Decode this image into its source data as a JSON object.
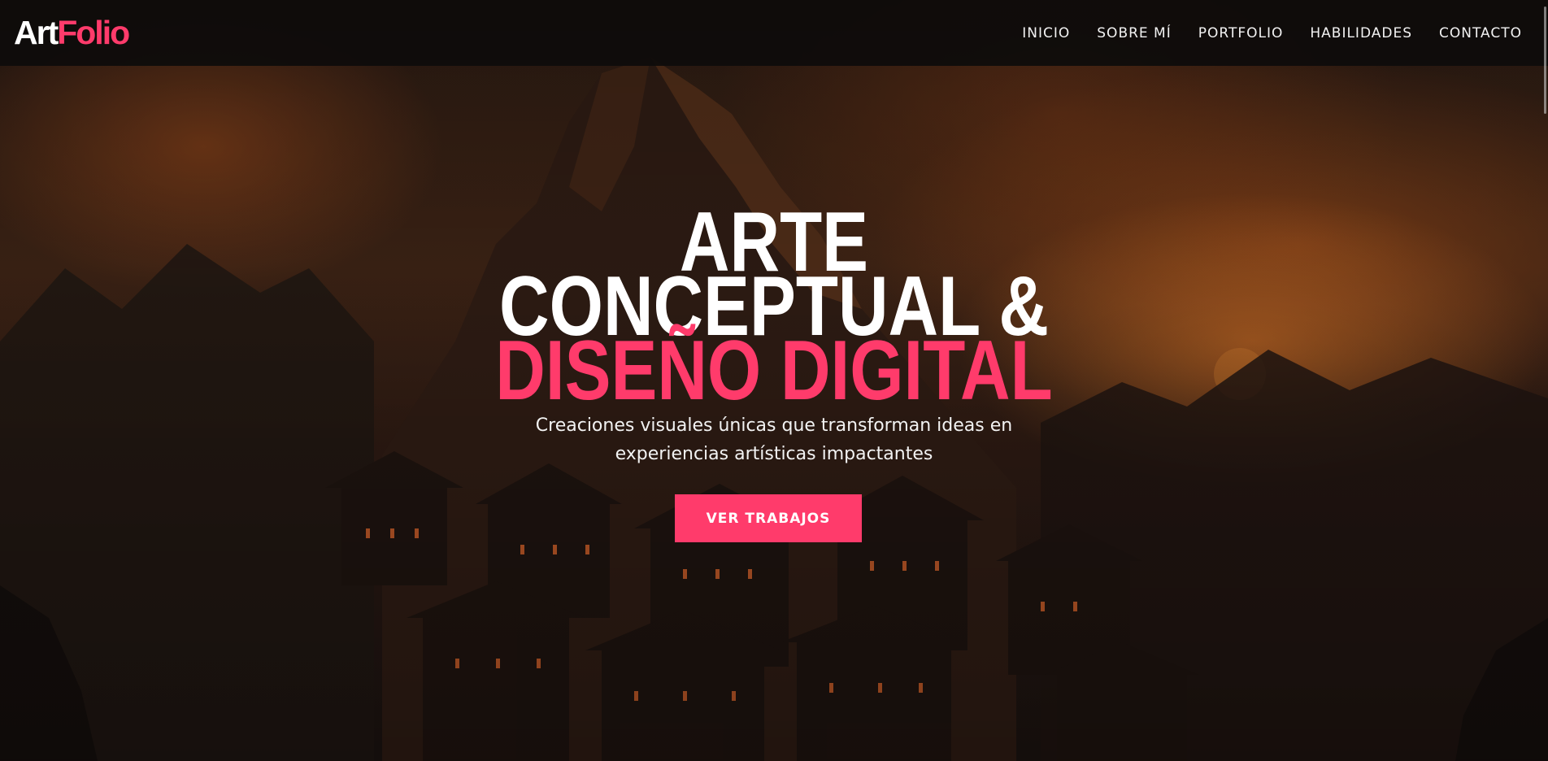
{
  "brand": {
    "logo_part1": "Art",
    "logo_part2": "Folio"
  },
  "nav": {
    "items": [
      {
        "label": "INICIO"
      },
      {
        "label": "SOBRE MÍ"
      },
      {
        "label": "PORTFOLIO"
      },
      {
        "label": "HABILIDADES"
      },
      {
        "label": "CONTACTO"
      }
    ]
  },
  "hero": {
    "title_line1": "ARTE",
    "title_line2": "CONCEPTUAL &",
    "title_line3": "DISEÑO DIGITAL",
    "subtitle_line1": "Creaciones visuales únicas que transforman ideas en",
    "subtitle_line2": "experiencias artísticas impactantes",
    "cta_label": "VER TRABAJOS",
    "background_icon": "mountain-village-painting"
  },
  "colors": {
    "accent": "#ff3b6b",
    "navbar": "#0e0c0b",
    "text": "#ffffff"
  }
}
